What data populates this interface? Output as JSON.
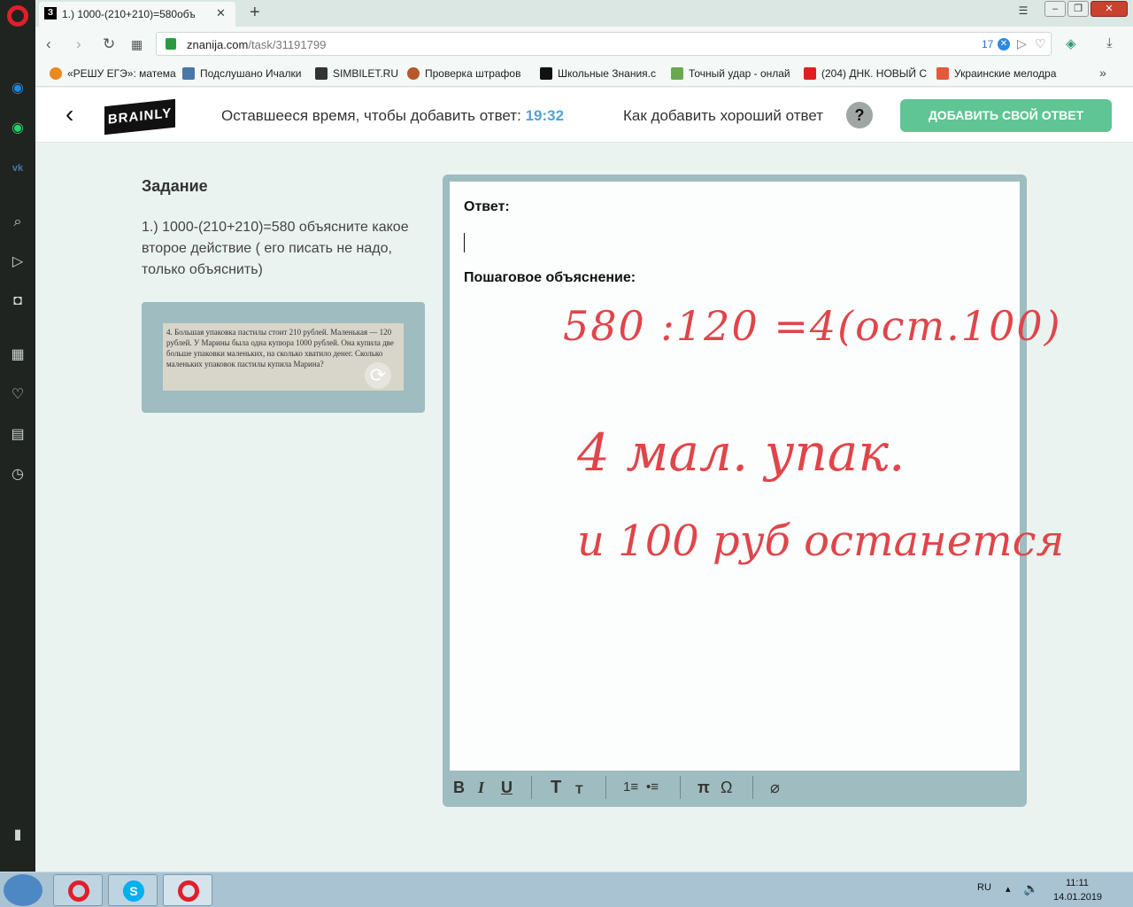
{
  "browser": {
    "tab_title": "1.) 1000-(210+210)=580объ",
    "tab_favicon": "З",
    "new_tab": "+",
    "url_domain": "znanija.com",
    "url_path": "/task/31191799",
    "url_badge": "17",
    "bookmarks": [
      {
        "label": "«РЕШУ ЕГЭ»: матема",
        "icon_color": "#e98a1f"
      },
      {
        "label": "Подслушано Ичалки",
        "icon_color": "#4a76a8"
      },
      {
        "label": "SIMBILET.RU",
        "icon_color": "#333333"
      },
      {
        "label": "Проверка штрафов",
        "icon_color": "#b5572c"
      },
      {
        "label": "Школьные Знания.с",
        "icon_color": "#111111"
      },
      {
        "label": "Точный удар - онлай",
        "icon_color": "#6aa84f"
      },
      {
        "label": "(204) ДНК. НОВЫЙ С",
        "icon_color": "#e02020"
      },
      {
        "label": "Украинские мелодра",
        "icon_color": "#e25a3c"
      }
    ],
    "bookmarks_more": "»"
  },
  "header": {
    "back": "‹",
    "logo": "BRAINLY",
    "timer_label": "Оставшееся время, чтобы добавить ответ:",
    "timer_value": "19:32",
    "how_to": "Как добавить хороший ответ",
    "help": "?",
    "add_answer": "ДОБАВИТЬ СВОЙ ОТВЕТ"
  },
  "task": {
    "title": "Задание",
    "text": "1.) 1000-(210+210)=580 объясните какое второе действие ( его писать не надо, только объяснить)",
    "image_text": "4. Большая упаковка пастилы стоит 210 рублей. Маленькая — 120 рублей. У Марины была одна купюра 1000 рублей. Она купила две больше упаковки маленьких, на сколько хватило денег. Сколько маленьких упаковок пастилы купила Марина?"
  },
  "editor": {
    "answer_label": "Ответ:",
    "explanation_label": "Пошаговое объяснение:",
    "handwriting": [
      "580 :120 =4(ост.100)",
      "4 мал. упак.",
      "и  100 руб  останется"
    ],
    "toolbar": {
      "bold": "B",
      "italic": "I",
      "underline": "U",
      "text_large": "T",
      "text_small": "T",
      "ordered_list": "1≡",
      "bullet_list": "•≡",
      "pi": "π",
      "omega": "Ω",
      "attach": "⌀"
    }
  },
  "system": {
    "lang": "RU",
    "time": "11:11",
    "date": "14.01.2019"
  },
  "colors": {
    "brand_green": "#5fc594",
    "timer_blue": "#4fa3d8",
    "ink_red": "#e0454a"
  }
}
